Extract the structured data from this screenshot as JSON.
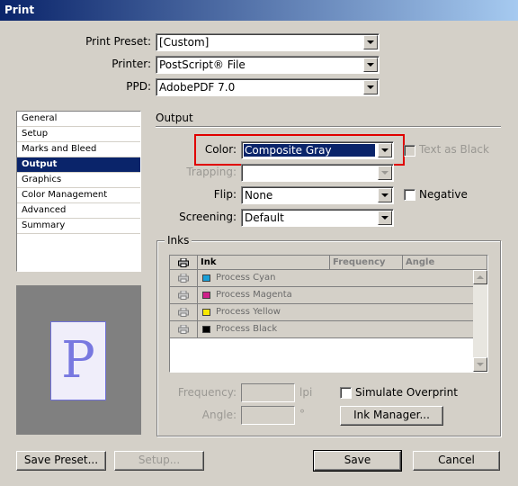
{
  "window": {
    "title": "Print"
  },
  "top": {
    "print_preset": {
      "label": "Print Preset:",
      "value": "[Custom]"
    },
    "printer": {
      "label": "Printer:",
      "value": "PostScript® File"
    },
    "ppd": {
      "label": "PPD:",
      "value": "AdobePDF 7.0"
    }
  },
  "sidebar": {
    "items": [
      {
        "label": "General"
      },
      {
        "label": "Setup"
      },
      {
        "label": "Marks and Bleed"
      },
      {
        "label": "Output",
        "selected": true
      },
      {
        "label": "Graphics"
      },
      {
        "label": "Color Management"
      },
      {
        "label": "Advanced"
      },
      {
        "label": "Summary"
      }
    ]
  },
  "preview": {
    "letter": "P"
  },
  "output": {
    "heading": "Output",
    "color": {
      "label": "Color:",
      "value": "Composite Gray"
    },
    "text_as_black": {
      "label": "Text as Black",
      "checked": false,
      "enabled": false
    },
    "trapping": {
      "label": "Trapping:",
      "value": "",
      "enabled": false
    },
    "flip": {
      "label": "Flip:",
      "value": "None"
    },
    "negative": {
      "label": "Negative",
      "checked": false
    },
    "screening": {
      "label": "Screening:",
      "value": "Default"
    }
  },
  "inks": {
    "heading": "Inks",
    "columns": [
      "Ink",
      "Frequency",
      "Angle"
    ],
    "rows": [
      {
        "name": "Process Cyan",
        "color": "#1aa0d8"
      },
      {
        "name": "Process Magenta",
        "color": "#d0208a"
      },
      {
        "name": "Process Yellow",
        "color": "#f8e800"
      },
      {
        "name": "Process Black",
        "color": "#000000"
      }
    ],
    "frequency": {
      "label": "Frequency:",
      "unit": "lpi",
      "value": ""
    },
    "angle": {
      "label": "Angle:",
      "unit": "°",
      "value": ""
    },
    "simulate_overprint": {
      "label": "Simulate Overprint",
      "checked": false
    },
    "ink_manager_label": "Ink Manager..."
  },
  "footer": {
    "save_preset": "Save Preset...",
    "setup": "Setup...",
    "save": "Save",
    "cancel": "Cancel"
  },
  "colors": {
    "highlight": "#0a246a",
    "annotation": "#e00000"
  }
}
